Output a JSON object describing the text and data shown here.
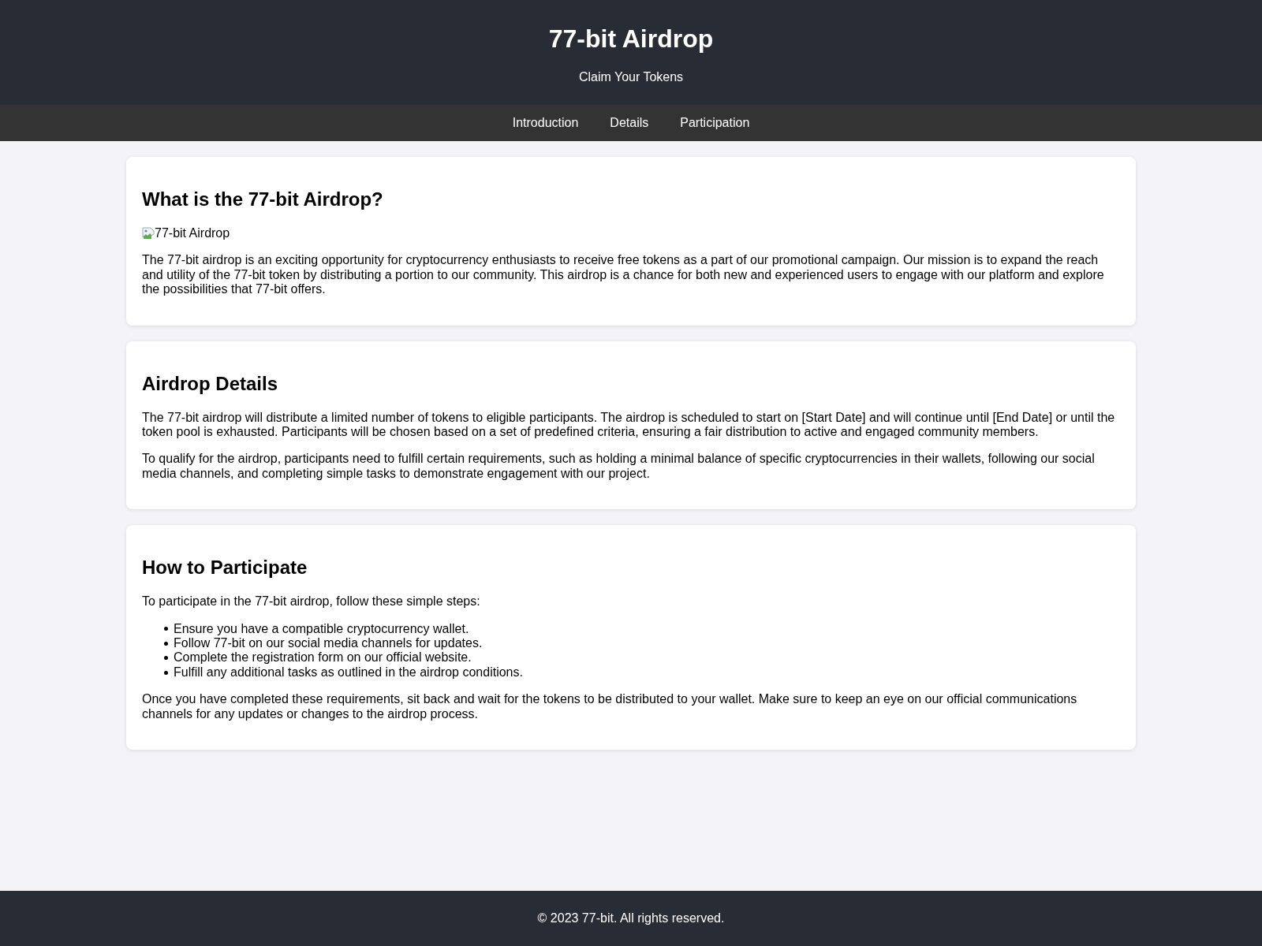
{
  "header": {
    "title": "77-bit Airdrop",
    "subtitle": "Claim Your Tokens"
  },
  "nav": {
    "links": [
      "Introduction",
      "Details",
      "Participation"
    ]
  },
  "sections": [
    {
      "heading": "What is the 77-bit Airdrop?",
      "blocks": [
        {
          "kind": "image",
          "alt": "77-bit Airdrop"
        },
        {
          "kind": "paragraph",
          "text": "The 77-bit airdrop is an exciting opportunity for cryptocurrency enthusiasts to receive free tokens as a part of our promotional campaign. Our mission is to expand the reach and utility of the 77-bit token by distributing a portion to our community. This airdrop is a chance for both new and experienced users to engage with our platform and explore the possibilities that 77-bit offers."
        }
      ]
    },
    {
      "heading": "Airdrop Details",
      "blocks": [
        {
          "kind": "paragraph",
          "text": "The 77-bit airdrop will distribute a limited number of tokens to eligible participants. The airdrop is scheduled to start on [Start Date] and will continue until [End Date] or until the token pool is exhausted. Participants will be chosen based on a set of predefined criteria, ensuring a fair distribution to active and engaged community members."
        },
        {
          "kind": "paragraph",
          "text": "To qualify for the airdrop, participants need to fulfill certain requirements, such as holding a minimal balance of specific cryptocurrencies in their wallets, following our social media channels, and completing simple tasks to demonstrate engagement with our project."
        }
      ]
    },
    {
      "heading": "How to Participate",
      "blocks": [
        {
          "kind": "paragraph",
          "text": "To participate in the 77-bit airdrop, follow these simple steps:"
        },
        {
          "kind": "list",
          "items": [
            "Ensure you have a compatible cryptocurrency wallet.",
            "Follow 77-bit on our social media channels for updates.",
            "Complete the registration form on our official website.",
            "Fulfill any additional tasks as outlined in the airdrop conditions."
          ]
        },
        {
          "kind": "paragraph",
          "text": "Once you have completed these requirements, sit back and wait for the tokens to be distributed to your wallet. Make sure to keep an eye on our official communications channels for any updates or changes to the airdrop process."
        }
      ]
    }
  ],
  "footer": {
    "text": "© 2023 77-bit. All rights reserved."
  }
}
